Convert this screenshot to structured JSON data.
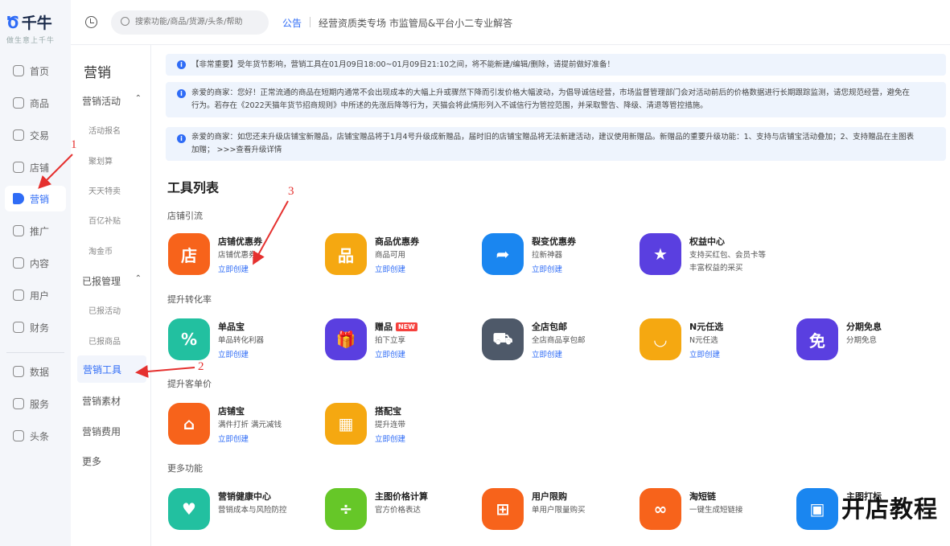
{
  "logo": {
    "name": "千牛",
    "tagline": "做生意上千牛"
  },
  "rail": {
    "items": [
      {
        "label": "首页",
        "icon": "home-icon"
      },
      {
        "label": "商品",
        "icon": "goods-icon"
      },
      {
        "label": "交易",
        "icon": "trade-icon"
      },
      {
        "label": "店铺",
        "icon": "shop-icon"
      },
      {
        "label": "营销",
        "icon": "megaphone-icon",
        "active": true
      },
      {
        "label": "推广",
        "icon": "promote-icon"
      },
      {
        "label": "内容",
        "icon": "content-icon"
      },
      {
        "label": "用户",
        "icon": "user-icon"
      },
      {
        "label": "财务",
        "icon": "finance-icon"
      },
      {
        "label": "数据",
        "icon": "data-icon"
      },
      {
        "label": "服务",
        "icon": "service-icon"
      },
      {
        "label": "头条",
        "icon": "headline-icon"
      }
    ]
  },
  "topbar": {
    "search_placeholder": "搜索功能/商品/货源/头条/帮助",
    "notice_label": "公告",
    "notice_text": "经营资质类专场 市监管局&平台小二专业解答"
  },
  "submenu": {
    "title": "营销",
    "group1": "营销活动",
    "group1_items": [
      "活动报名",
      "聚划算",
      "天天特卖",
      "百亿补贴",
      "淘金币"
    ],
    "group2": "已报管理",
    "group2_items": [
      "已报活动",
      "已报商品"
    ],
    "active": "营销工具",
    "others": [
      "营销素材",
      "营销费用",
      "更多"
    ]
  },
  "alerts": [
    {
      "line1": "【非常重要】受年货节影响，营销工具在01月09日18:00~01月09日21:10之间，将不能新建/编辑/删除，请提前做好准备！",
      "line2": ""
    },
    {
      "line1": "亲爱的商家：您好！正常流通的商品在短期内通常不会出现成本的大幅上升或骤然下降而引发价格大幅波动，为倡导诚信经营，市场监督管理部门会对活动前后的价格数据进行长期跟踪监测，请您规范经营，避免在",
      "line2": "行为。若存在《2022天猫年货节招商规则》中所述的先涨后降等行为，天猫会将此情形列入不诚信行为管控范围，并采取警告、降级、清退等管控措施。"
    },
    {
      "line1": "亲爱的商家：如您还未升级店铺宝新赠品，店铺宝赠品将于1月4号升级成新赠品，届时旧的店铺宝赠品将无法新建活动，建议使用新赠品。新赠品的重要升级功能：1、支持与店铺宝活动叠加；2、支持赠品在主图表",
      "line2": "加赠；  >>>查看升级详情"
    }
  ],
  "tools": {
    "title": "工具列表",
    "sections": [
      {
        "name": "店铺引流",
        "cards": [
          {
            "name": "店铺优惠券",
            "desc": "店铺优惠券",
            "link": "立即创建",
            "icon": "coupon-icon",
            "color": "#f7631b"
          },
          {
            "name": "商品优惠券",
            "desc": "商品可用",
            "link": "立即创建",
            "icon": "ticket-icon",
            "color": "#f5a811"
          },
          {
            "name": "裂变优惠券",
            "desc": "拉新神器",
            "link": "立即创建",
            "icon": "share-arrow-icon",
            "color": "#1a86f0"
          },
          {
            "name": "权益中心",
            "desc": "支持买红包、会员卡等",
            "desc2": "丰富权益的采买",
            "icon": "star-badge-icon",
            "color": "#5a3fe0"
          }
        ]
      },
      {
        "name": "提升转化率",
        "cards": [
          {
            "name": "单品宝",
            "desc": "单品转化利器",
            "link": "立即创建",
            "icon": "discount-tag-icon",
            "color": "#22c0a0"
          },
          {
            "name": "赠品",
            "badge": "NEW",
            "desc": "拍下立享",
            "link": "立即创建",
            "icon": "gift-icon",
            "color": "#5a3fe0"
          },
          {
            "name": "全店包邮",
            "desc": "全店商品享包邮",
            "link": "立即创建",
            "icon": "truck-icon",
            "color": "#4e5969"
          },
          {
            "name": "N元任选",
            "desc": "N元任选",
            "link": "立即创建",
            "icon": "shopping-bag-icon",
            "color": "#f5a811"
          },
          {
            "name": "分期免息",
            "desc": "分期免息",
            "icon": "installment-icon",
            "color": "#5a3fe0"
          }
        ]
      },
      {
        "name": "提升客单价",
        "cards": [
          {
            "name": "店铺宝",
            "desc": "满件打折 满元减钱",
            "link": "立即创建",
            "icon": "store-icon",
            "color": "#f7631b"
          },
          {
            "name": "搭配宝",
            "desc": "提升连带",
            "link": "立即创建",
            "icon": "layout-icon",
            "color": "#f5a811"
          }
        ]
      },
      {
        "name": "更多功能",
        "cards": [
          {
            "name": "营销健康中心",
            "desc": "营销成本与风险防控",
            "icon": "health-icon",
            "color": "#22c0a0"
          },
          {
            "name": "主图价格计算",
            "desc": "官方价格表达",
            "icon": "calculator-icon",
            "color": "#66c728"
          },
          {
            "name": "用户限购",
            "desc": "单用户限量购买",
            "icon": "cart-limit-icon",
            "color": "#f7631b"
          },
          {
            "name": "淘短链",
            "desc": "一键生成短链接",
            "icon": "link-icon",
            "color": "#f7631b"
          },
          {
            "name": "主图打标",
            "desc": "",
            "icon": "mark-icon",
            "color": "#1a86f0"
          }
        ]
      }
    ]
  },
  "annotations": [
    "1",
    "2",
    "3"
  ],
  "overlay": "开店教程"
}
